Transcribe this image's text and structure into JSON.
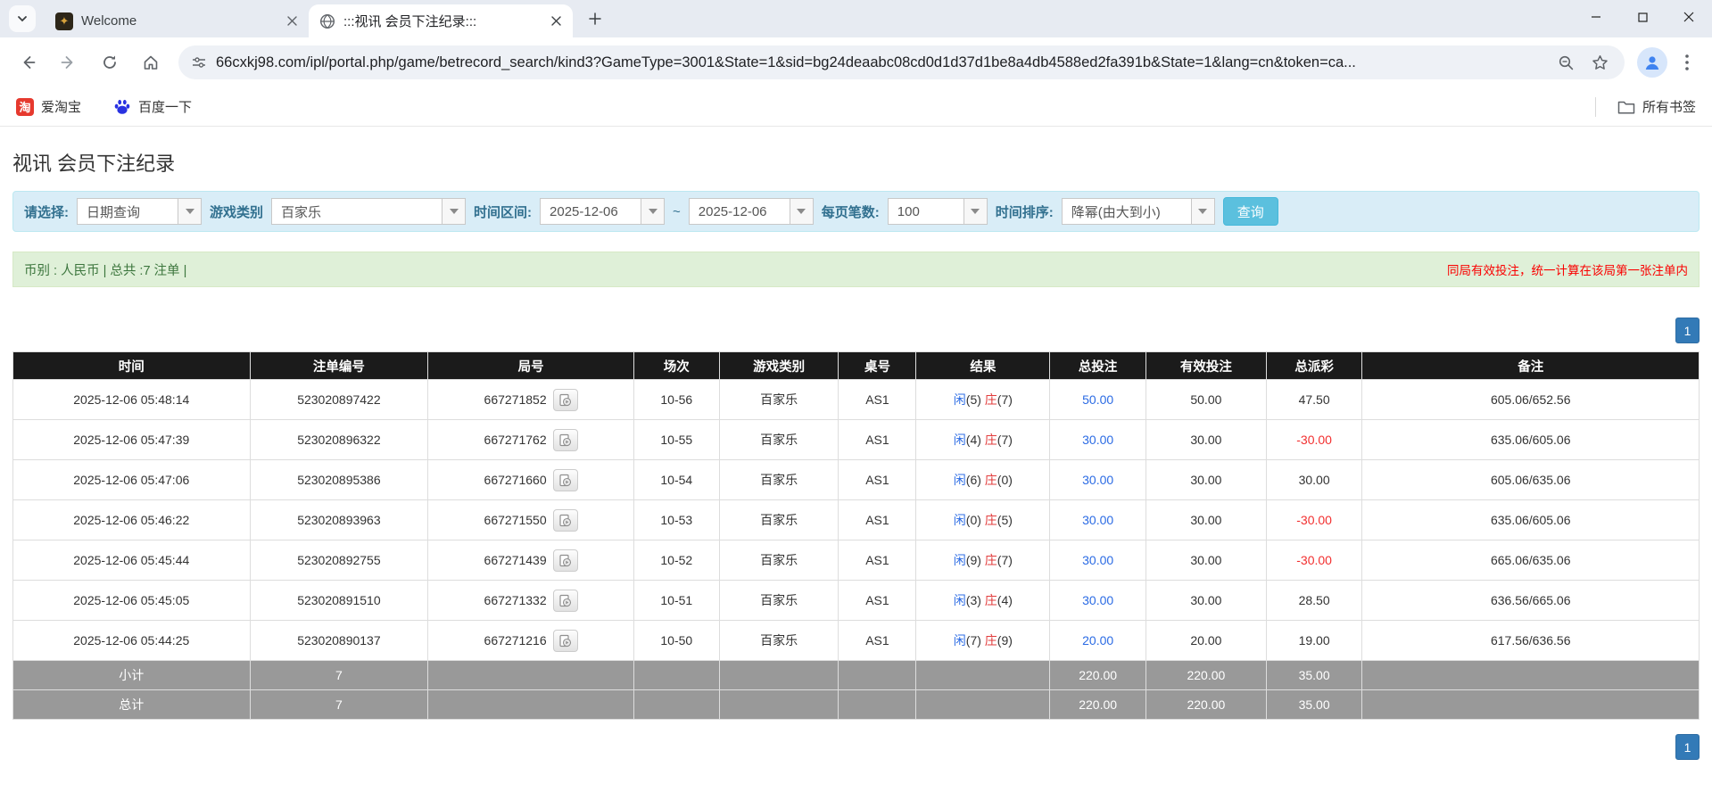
{
  "browser": {
    "tabs": [
      {
        "title": "Welcome"
      },
      {
        "title": ":::视讯 会员下注纪录:::"
      }
    ],
    "url": "66cxkj98.com/ipl/portal.php/game/betrecord_search/kind3?GameType=3001&State=1&sid=bg24deaabc08cd0d1d37d1be8a4db4588ed2fa391b&State=1&lang=cn&token=ca...",
    "bookmarks": [
      {
        "label": "爱淘宝",
        "icon_char": "淘"
      },
      {
        "label": "百度一下"
      }
    ],
    "all_bookmarks_label": "所有书签"
  },
  "page": {
    "title": "视讯 会员下注纪录",
    "filters": {
      "select_label": "请选择:",
      "select_value": "日期查询",
      "game_type_label": "游戏类别",
      "game_type_value": "百家乐",
      "date_range_label": "时间区间:",
      "date_from": "2025-12-06",
      "range_separator": "~",
      "date_to": "2025-12-06",
      "page_size_label": "每页笔数:",
      "page_size_value": "100",
      "sort_label": "时间排序:",
      "sort_value": "降幂(由大到小)",
      "search_button": "查询"
    },
    "summary": {
      "left": "币别 : 人民币 | 总共 :7 注单 |",
      "right": "同局有效投注，统一计算在该局第一张注单内"
    },
    "pagination_label": "1",
    "table": {
      "headers": [
        "时间",
        "注单编号",
        "局号",
        "场次",
        "游戏类别",
        "桌号",
        "结果",
        "总投注",
        "有效投注",
        "总派彩",
        "备注"
      ],
      "rows": [
        {
          "time": "2025-12-06 05:48:14",
          "bet_id": "523020897422",
          "round_id": "667271852",
          "session": "10-56",
          "game": "百家乐",
          "table_no": "AS1",
          "player": "闲",
          "player_score": "(5)",
          "banker": "庄",
          "banker_score": "(7)",
          "total_bet": "50.00",
          "valid_bet": "50.00",
          "payout": "47.50",
          "note": "605.06/652.56"
        },
        {
          "time": "2025-12-06 05:47:39",
          "bet_id": "523020896322",
          "round_id": "667271762",
          "session": "10-55",
          "game": "百家乐",
          "table_no": "AS1",
          "player": "闲",
          "player_score": "(4)",
          "banker": "庄",
          "banker_score": "(7)",
          "total_bet": "30.00",
          "valid_bet": "30.00",
          "payout": "-30.00",
          "note": "635.06/605.06"
        },
        {
          "time": "2025-12-06 05:47:06",
          "bet_id": "523020895386",
          "round_id": "667271660",
          "session": "10-54",
          "game": "百家乐",
          "table_no": "AS1",
          "player": "闲",
          "player_score": "(6)",
          "banker": "庄",
          "banker_score": "(0)",
          "total_bet": "30.00",
          "valid_bet": "30.00",
          "payout": "30.00",
          "note": "605.06/635.06"
        },
        {
          "time": "2025-12-06 05:46:22",
          "bet_id": "523020893963",
          "round_id": "667271550",
          "session": "10-53",
          "game": "百家乐",
          "table_no": "AS1",
          "player": "闲",
          "player_score": "(0)",
          "banker": "庄",
          "banker_score": "(5)",
          "total_bet": "30.00",
          "valid_bet": "30.00",
          "payout": "-30.00",
          "note": "635.06/605.06"
        },
        {
          "time": "2025-12-06 05:45:44",
          "bet_id": "523020892755",
          "round_id": "667271439",
          "session": "10-52",
          "game": "百家乐",
          "table_no": "AS1",
          "player": "闲",
          "player_score": "(9)",
          "banker": "庄",
          "banker_score": "(7)",
          "total_bet": "30.00",
          "valid_bet": "30.00",
          "payout": "-30.00",
          "note": "665.06/635.06"
        },
        {
          "time": "2025-12-06 05:45:05",
          "bet_id": "523020891510",
          "round_id": "667271332",
          "session": "10-51",
          "game": "百家乐",
          "table_no": "AS1",
          "player": "闲",
          "player_score": "(3)",
          "banker": "庄",
          "banker_score": "(4)",
          "total_bet": "30.00",
          "valid_bet": "30.00",
          "payout": "28.50",
          "note": "636.56/665.06"
        },
        {
          "time": "2025-12-06 05:44:25",
          "bet_id": "523020890137",
          "round_id": "667271216",
          "session": "10-50",
          "game": "百家乐",
          "table_no": "AS1",
          "player": "闲",
          "player_score": "(7)",
          "banker": "庄",
          "banker_score": "(9)",
          "total_bet": "20.00",
          "valid_bet": "20.00",
          "payout": "19.00",
          "note": "617.56/636.56"
        }
      ],
      "subtotal_row": {
        "label": "小计",
        "count": "7",
        "total_bet": "220.00",
        "valid_bet": "220.00",
        "payout": "35.00"
      },
      "total_row": {
        "label": "总计",
        "count": "7",
        "total_bet": "220.00",
        "valid_bet": "220.00",
        "payout": "35.00"
      }
    },
    "colors": {
      "accent_blue": "#337ab7",
      "info_bg": "#d9edf7",
      "success_bg": "#dff0d8",
      "link_blue": "#2b6be4",
      "banker_red": "#e23c3c",
      "negative_red": "#f23030",
      "header_black": "#1b1b1b",
      "footer_gray": "#999999"
    }
  }
}
